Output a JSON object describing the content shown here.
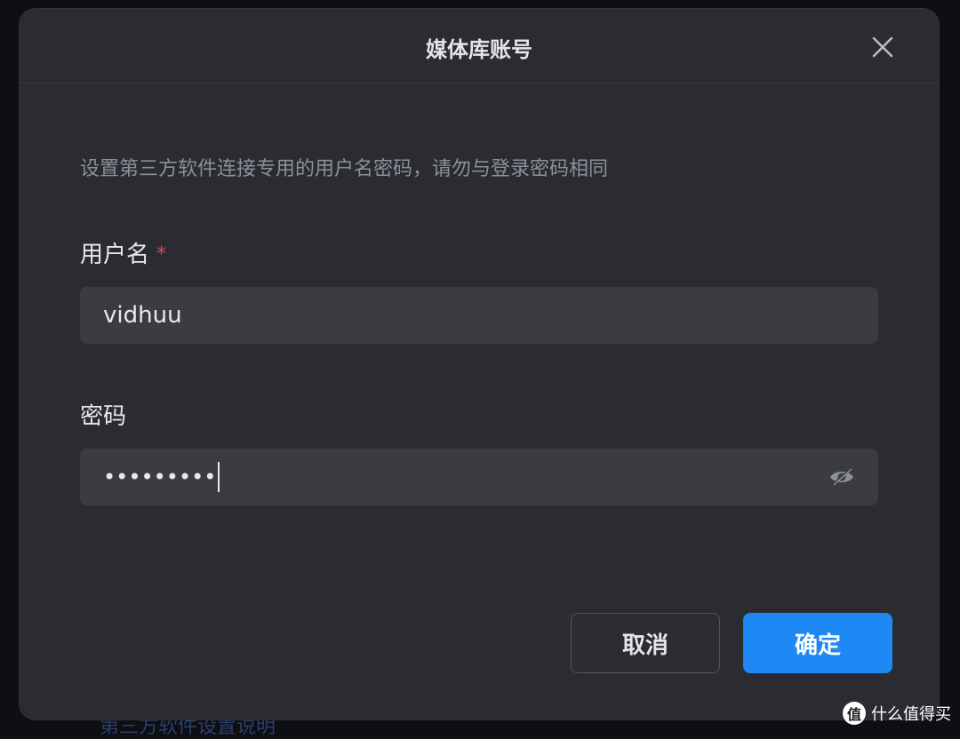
{
  "background": {
    "link_text": "第三方软件设置说明"
  },
  "dialog": {
    "title": "媒体库账号",
    "close_icon": "close-icon",
    "description": "设置第三方软件连接专用的用户名密码，请勿与登录密码相同",
    "username": {
      "label": "用户名",
      "required_mark": "*",
      "value": "vidhuu"
    },
    "password": {
      "label": "密码",
      "masked_value": "•••••••••",
      "toggle_icon": "eye-hidden-icon"
    },
    "buttons": {
      "cancel": "取消",
      "confirm": "确定"
    }
  },
  "watermark": {
    "logo": "值",
    "text": "什么值得买"
  },
  "colors": {
    "dialog_bg": "#2a2c31",
    "input_bg": "#3a3c42",
    "primary": "#1e88f5",
    "required": "#e5484d"
  }
}
